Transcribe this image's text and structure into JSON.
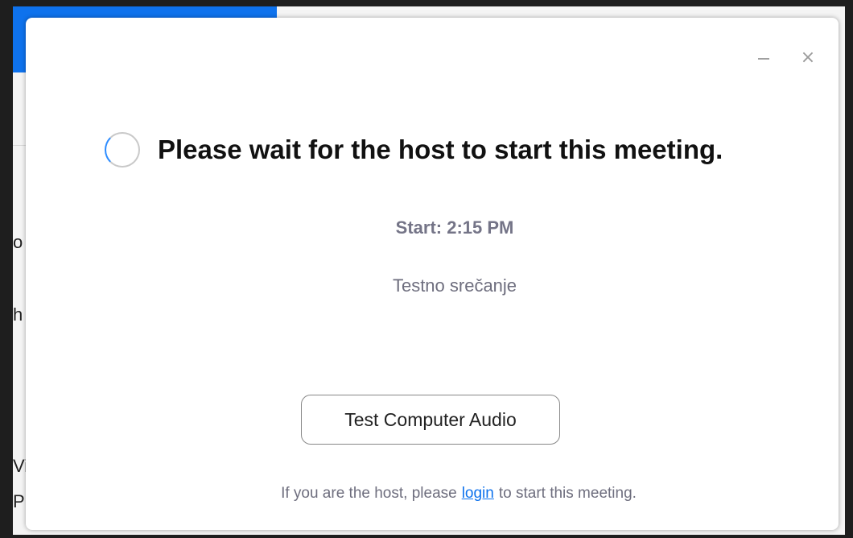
{
  "background_app": {
    "fragments": [
      "o",
      "h",
      "Vi",
      "Pr"
    ]
  },
  "dialog": {
    "controls": {
      "minimize_icon": "minimize-icon",
      "close_glyph": "×"
    },
    "spinner_icon": "loading-spinner-icon",
    "title": "Please wait for the host to start this meeting.",
    "start_time": "Start: 2:15 PM",
    "meeting_name": "Testno srečanje",
    "test_audio_label": "Test Computer Audio",
    "footer": {
      "prefix": "If you are the host, please",
      "link": "login",
      "suffix": "to start this meeting."
    }
  },
  "colors": {
    "accent": "#0e72ed",
    "spinner": "#2d8cff",
    "muted_text": "#747487"
  }
}
